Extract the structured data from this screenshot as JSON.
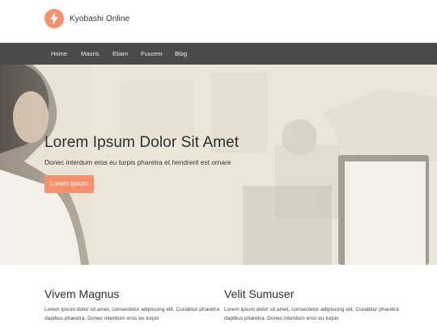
{
  "header": {
    "site_title": "Kyobashi Online",
    "logo_icon": "lightning-bolt-icon",
    "accent_color": "#f7916b"
  },
  "nav": {
    "items": [
      {
        "label": "Home"
      },
      {
        "label": "Mauris"
      },
      {
        "label": "Etiam"
      },
      {
        "label": "Fuscem"
      },
      {
        "label": "Blog"
      }
    ],
    "background": "#4a4a4a"
  },
  "hero": {
    "title": "Lorem Ipsum Dolor Sit Amet",
    "subtitle": "Donec interdum eros eu turpis pharetra et hendrerit est ornare",
    "button_label": "Lorem Ipsum"
  },
  "features": [
    {
      "title": "Vivem Magnus",
      "text": "Lorem ipsum dolor sit amet, consectetur adipiscing elit. Curabitur pharetra dapibus pharetra. Donec interdum eros eu turpis"
    },
    {
      "title": "Velit Sumuser",
      "text": "Lorem ipsum dolor sit amet, consectetur adipiscing elit. Curabitur pharetra dapibus pharetra. Donec interdum eros eu turpis"
    }
  ]
}
